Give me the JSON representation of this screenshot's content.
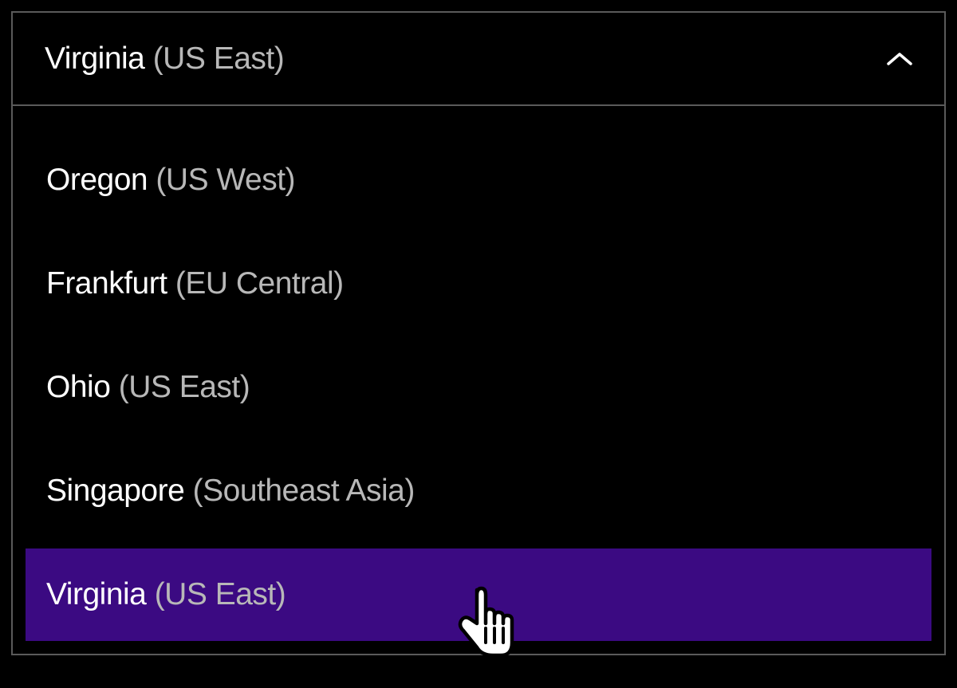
{
  "dropdown": {
    "selected": {
      "primary": "Virginia",
      "secondary": " (US East)"
    },
    "options": [
      {
        "primary": "Oregon",
        "secondary": " (US West)",
        "highlighted": false
      },
      {
        "primary": "Frankfurt",
        "secondary": " (EU Central)",
        "highlighted": false
      },
      {
        "primary": "Ohio",
        "secondary": " (US East)",
        "highlighted": false
      },
      {
        "primary": "Singapore",
        "secondary": " (Southeast Asia)",
        "highlighted": false
      },
      {
        "primary": "Virginia",
        "secondary": " (US East)",
        "highlighted": true
      }
    ]
  },
  "colors": {
    "highlight": "#3b0a82",
    "border": "#5a5a5a",
    "textPrimary": "#ffffff",
    "textSecondary": "#b8b8b8",
    "background": "#000000"
  }
}
